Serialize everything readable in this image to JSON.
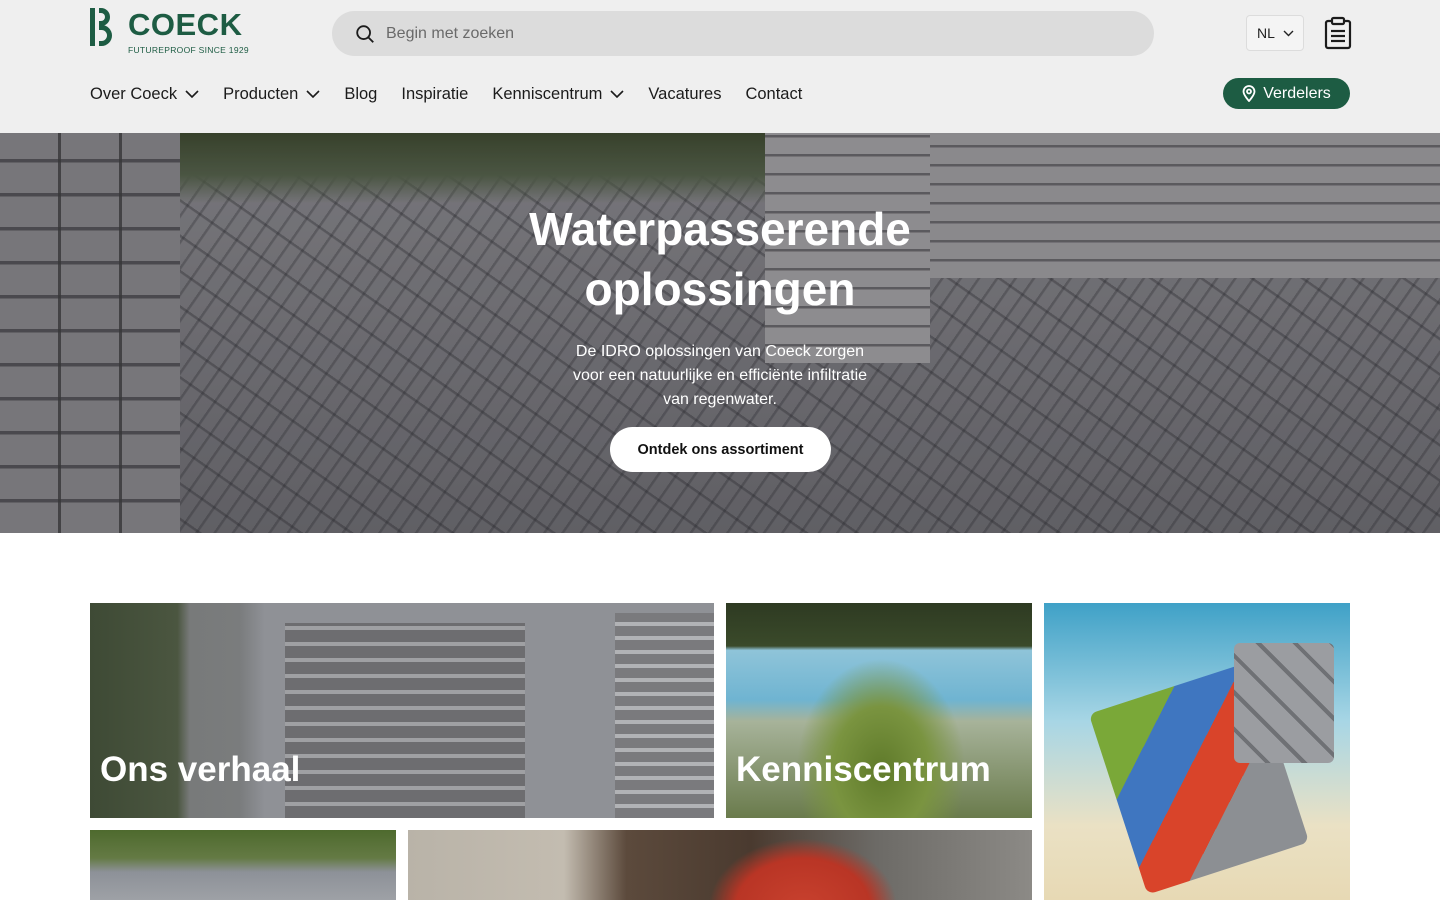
{
  "brand": {
    "name": "COECK",
    "tagline": "FUTUREPROOF SINCE 1929",
    "color": "#1d5c43"
  },
  "search": {
    "placeholder": "Begin met zoeken",
    "value": "",
    "icon": "search-icon"
  },
  "language": {
    "selected": "NL"
  },
  "header_icons": {
    "list_icon": "clipboard-icon"
  },
  "nav": {
    "items": [
      {
        "label": "Over Coeck",
        "has_dropdown": true
      },
      {
        "label": "Producten",
        "has_dropdown": true
      },
      {
        "label": "Blog",
        "has_dropdown": false
      },
      {
        "label": "Inspiratie",
        "has_dropdown": false
      },
      {
        "label": "Kenniscentrum",
        "has_dropdown": true
      },
      {
        "label": "Vacatures",
        "has_dropdown": false
      },
      {
        "label": "Contact",
        "has_dropdown": false
      }
    ],
    "cta_label": "Verdelers",
    "cta_icon": "map-pin-icon"
  },
  "hero": {
    "title_line1": "Waterpasserende",
    "title_line2": "oplossingen",
    "description_line1": "De IDRO oplossingen van Coeck zorgen",
    "description_line2": "voor een natuurlijke en efficiënte infiltratie",
    "description_line3": "van regenwater.",
    "button_label": "Ontdek ons assortiment"
  },
  "tiles": [
    {
      "label": "Ons verhaal"
    },
    {
      "label": "Kenniscentrum"
    },
    {
      "label": ""
    },
    {
      "label": ""
    },
    {
      "label": ""
    }
  ]
}
